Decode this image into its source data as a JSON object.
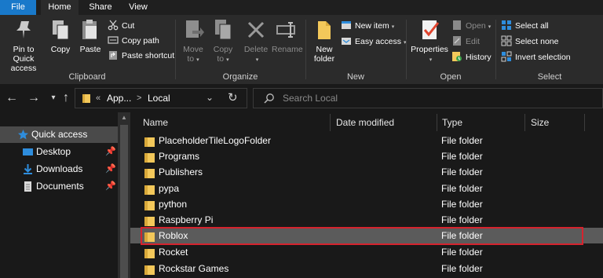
{
  "tabs": {
    "file": "File",
    "home": "Home",
    "share": "Share",
    "view": "View"
  },
  "ribbon": {
    "clipboard": {
      "label": "Clipboard",
      "pin_line1": "Pin to Quick",
      "pin_line2": "access",
      "copy": "Copy",
      "paste": "Paste",
      "cut": "Cut",
      "copy_path": "Copy path",
      "paste_shortcut": "Paste shortcut"
    },
    "organize": {
      "label": "Organize",
      "move_to_line1": "Move",
      "move_to_line2": "to",
      "copy_to_line1": "Copy",
      "copy_to_line2": "to",
      "delete": "Delete",
      "rename": "Rename"
    },
    "new": {
      "label": "New",
      "new_folder_line1": "New",
      "new_folder_line2": "folder",
      "new_item": "New item",
      "easy_access": "Easy access"
    },
    "open": {
      "label": "Open",
      "properties": "Properties",
      "open": "Open",
      "edit": "Edit",
      "history": "History"
    },
    "select": {
      "label": "Select",
      "select_all": "Select all",
      "select_none": "Select none",
      "invert_selection": "Invert selection"
    }
  },
  "address": {
    "overflow": "«",
    "crumb1": "App...",
    "crumb_sep": ">",
    "crumb2": "Local",
    "search_placeholder": "Search Local"
  },
  "navpane": {
    "items": [
      {
        "label": "Quick access",
        "icon": "star-icon"
      },
      {
        "label": "Desktop",
        "icon": "desktop-icon"
      },
      {
        "label": "Downloads",
        "icon": "download-icon"
      },
      {
        "label": "Documents",
        "icon": "documents-icon"
      }
    ]
  },
  "columns": {
    "name": "Name",
    "date_modified": "Date modified",
    "type": "Type",
    "size": "Size"
  },
  "files": [
    {
      "name": "PlaceholderTileLogoFolder",
      "type": "File folder"
    },
    {
      "name": "Programs",
      "type": "File folder"
    },
    {
      "name": "Publishers",
      "type": "File folder"
    },
    {
      "name": "pypa",
      "type": "File folder"
    },
    {
      "name": "python",
      "type": "File folder"
    },
    {
      "name": "Raspberry Pi",
      "type": "File folder"
    },
    {
      "name": "Roblox",
      "type": "File folder"
    },
    {
      "name": "Rocket",
      "type": "File folder"
    },
    {
      "name": "Rockstar Games",
      "type": "File folder"
    }
  ],
  "selected_file": "Roblox",
  "colors": {
    "file_tab": "#1979ca",
    "highlight_border": "#d6232e",
    "folder_yellow": "#f3c85a",
    "accent_blue": "#2e8ddd"
  }
}
